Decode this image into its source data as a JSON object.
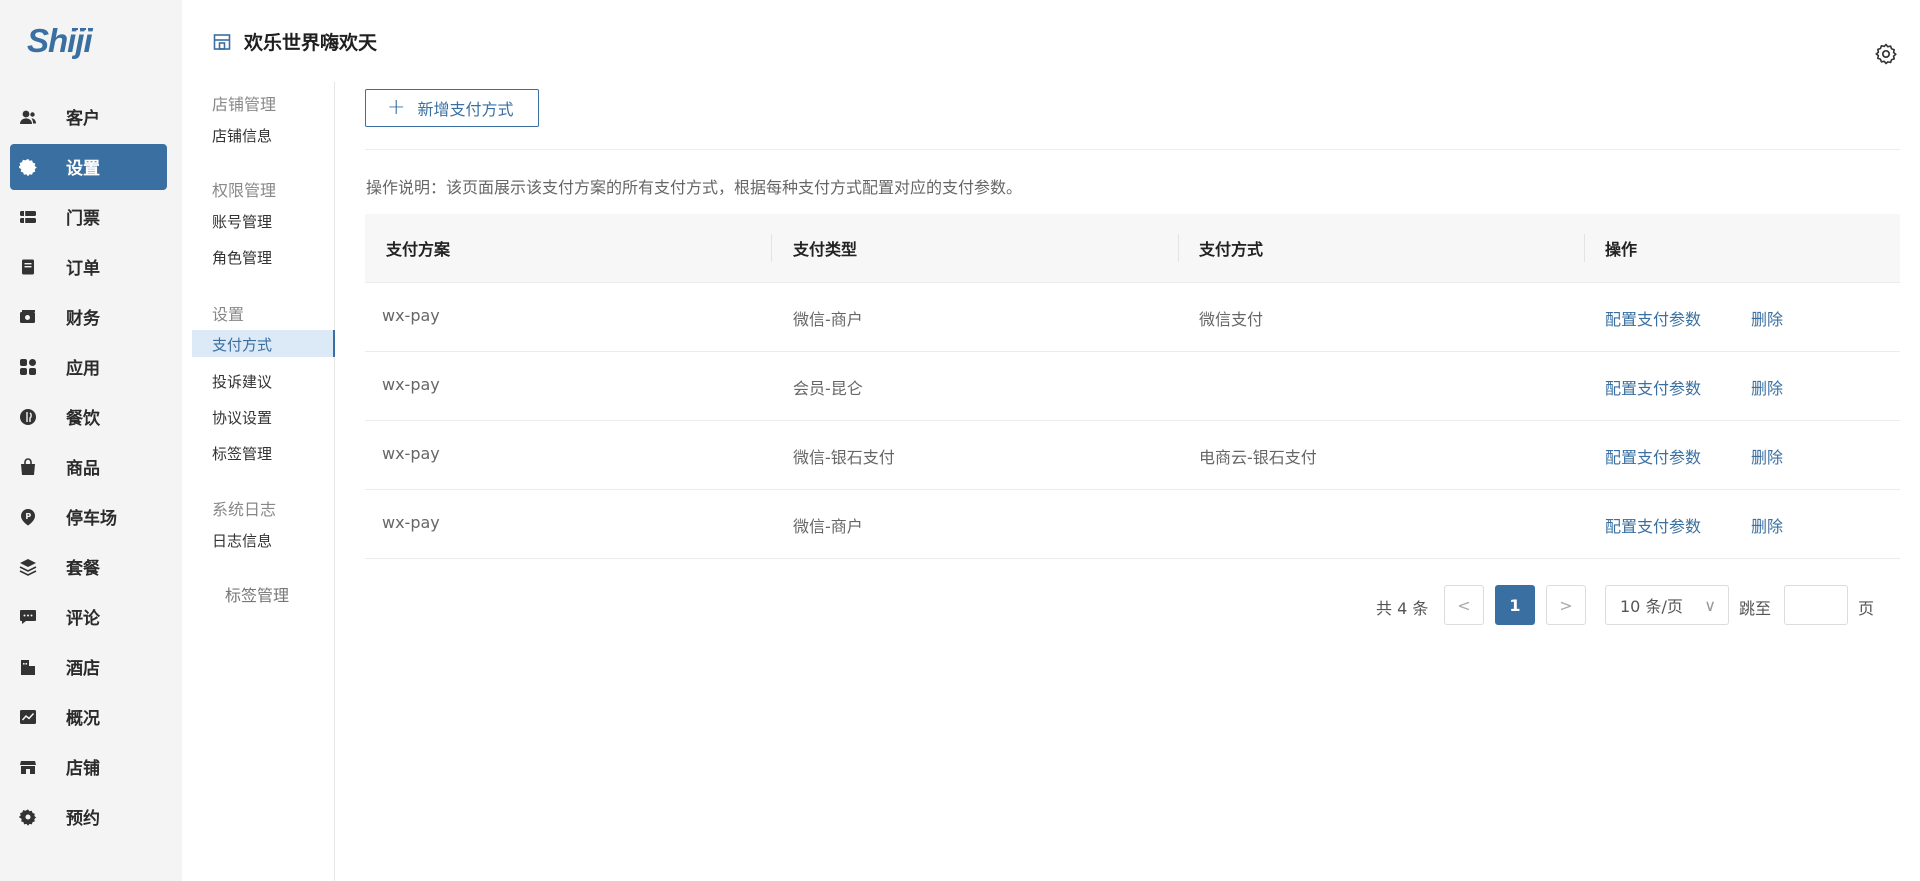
{
  "brand": {
    "logo_text": "Shiji",
    "accent": "#3a6fa1"
  },
  "nav": {
    "items": [
      {
        "label": "客户",
        "icon": "user-icon",
        "active": false
      },
      {
        "label": "设置",
        "icon": "gear-icon",
        "active": true
      },
      {
        "label": "门票",
        "icon": "ticket-icon",
        "active": false
      },
      {
        "label": "订单",
        "icon": "order-icon",
        "active": false
      },
      {
        "label": "财务",
        "icon": "finance-icon",
        "active": false
      },
      {
        "label": "应用",
        "icon": "apps-icon",
        "active": false
      },
      {
        "label": "餐饮",
        "icon": "dining-icon",
        "active": false
      },
      {
        "label": "商品",
        "icon": "bag-icon",
        "active": false
      },
      {
        "label": "停车场",
        "icon": "parking-icon",
        "active": false
      },
      {
        "label": "套餐",
        "icon": "layers-icon",
        "active": false
      },
      {
        "label": "评论",
        "icon": "comment-icon",
        "active": false
      },
      {
        "label": "酒店",
        "icon": "hotel-icon",
        "active": false
      },
      {
        "label": "概况",
        "icon": "chart-icon",
        "active": false
      },
      {
        "label": "店铺",
        "icon": "store-icon",
        "active": false
      },
      {
        "label": "预约",
        "icon": "gear-icon",
        "active": false
      }
    ]
  },
  "header": {
    "title": "欢乐世界嗨欢天"
  },
  "subnav": {
    "groups": [
      {
        "title": "店铺管理",
        "items": [
          "店铺信息"
        ]
      },
      {
        "title": "权限管理",
        "items": [
          "账号管理",
          "角色管理"
        ]
      },
      {
        "title": "设置",
        "items": [
          "支付方式",
          "投诉建议",
          "协议设置",
          "标签管理"
        ]
      },
      {
        "title": "系统日志",
        "items": [
          "日志信息"
        ]
      }
    ],
    "active_item": "支付方式",
    "extra_label": "标签管理"
  },
  "main": {
    "add_button_label": "新增支付方式",
    "description": "操作说明：该页面展示该支付方案的所有支付方式，根据每种支付方式配置对应的支付参数。",
    "table": {
      "columns": [
        "支付方案",
        "支付类型",
        "支付方式",
        "操作"
      ],
      "rows": [
        {
          "scheme": "wx-pay",
          "type": "微信-商户",
          "method": "微信支付",
          "action_config": "配置支付参数",
          "action_delete": "删除"
        },
        {
          "scheme": "wx-pay",
          "type": "会员-昆仑",
          "method": "",
          "action_config": "配置支付参数",
          "action_delete": "删除"
        },
        {
          "scheme": "wx-pay",
          "type": "微信-银石支付",
          "method": "电商云-银石支付",
          "action_config": "配置支付参数",
          "action_delete": "删除"
        },
        {
          "scheme": "wx-pay",
          "type": "微信-商户",
          "method": "",
          "action_config": "配置支付参数",
          "action_delete": "删除"
        }
      ]
    },
    "pagination": {
      "total_text": "共 4 条",
      "prev": "<",
      "current_page": "1",
      "next": ">",
      "page_size": "10 条/页",
      "jump_label": "跳至",
      "jump_value": "",
      "jump_suffix": "页"
    }
  }
}
